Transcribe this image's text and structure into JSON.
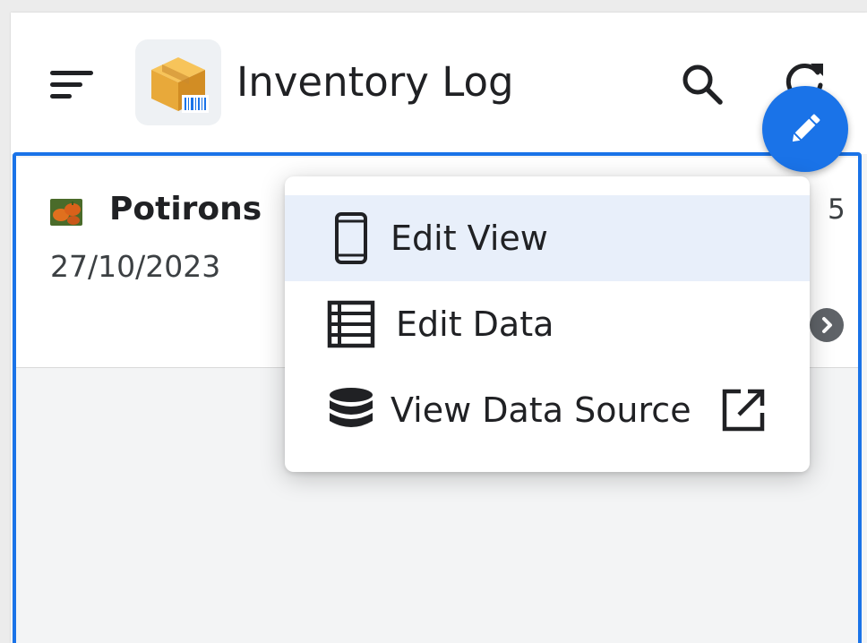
{
  "app": {
    "title": "Inventory Log",
    "logo_icon": "package-barcode-icon",
    "menu_icon": "menu-icon",
    "search_icon": "search-icon",
    "refresh_icon": "refresh-icon"
  },
  "fab": {
    "icon": "pencil-icon",
    "color": "#1a73e8"
  },
  "list": {
    "rows": [
      {
        "title": "Potirons",
        "date": "27/10/2023",
        "quantity": "5",
        "thumbnail_icon": "pumpkin-thumbnail",
        "chevron_icon": "chevron-right-icon"
      }
    ]
  },
  "menu": {
    "items": [
      {
        "label": "Edit View",
        "icon": "phone-icon",
        "active": true
      },
      {
        "label": "Edit Data",
        "icon": "table-icon",
        "active": false
      },
      {
        "label": "View Data Source",
        "icon": "database-icon",
        "trailing_icon": "open-in-new-icon",
        "active": false
      }
    ]
  },
  "colors": {
    "accent": "#1a73e8",
    "menu_highlight": "#e8effa",
    "content_bg": "#f3f4f5"
  }
}
